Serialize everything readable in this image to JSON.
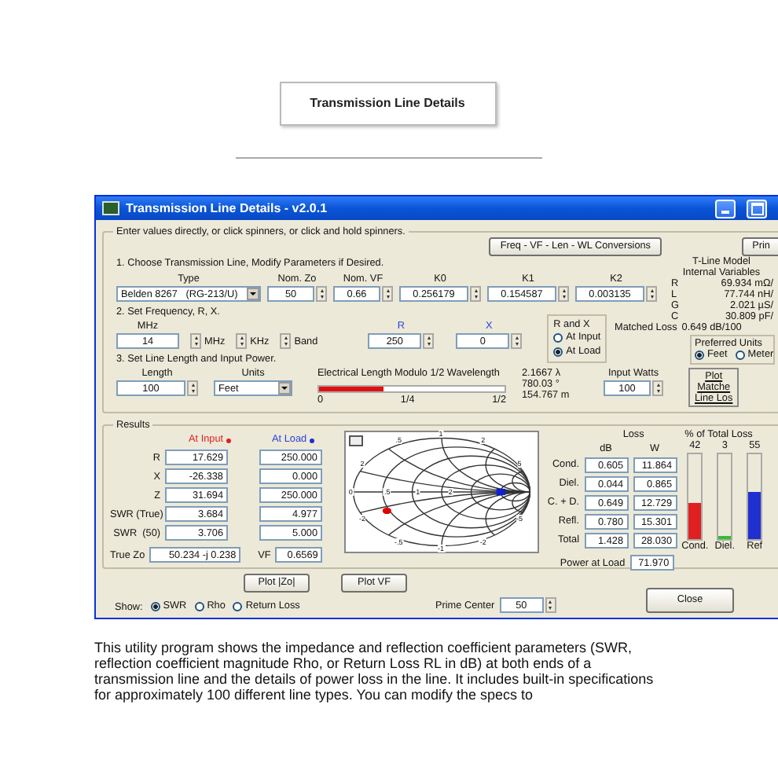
{
  "page": {
    "title": "Transmission Line Details",
    "description": "This utility program shows the impedance and reflection coefficient parameters (SWR, reflection coefficient magnitude Rho, or Return Loss RL in dB) at both ends of a transmission line and the details of power loss in the line. It includes built-in specifications for approximately 100 different line types. You can modify the specs to"
  },
  "window": {
    "title": "Transmission Line Details - v2.0.1"
  },
  "inputs": {
    "legend": "Enter values directly, or click spinners, or click and hold spinners.",
    "conversions_button": "Freq - VF - Len - WL Conversions",
    "print_button": "Prin",
    "step1": "1. Choose Transmission Line, Modify Parameters if Desired.",
    "line_params": [
      {
        "label": "Type",
        "value": "Belden 8267   (RG-213/U)",
        "kind": "dropdown"
      },
      {
        "label": "Nom. Zo",
        "value": "50",
        "kind": "spinner"
      },
      {
        "label": "Nom. VF",
        "value": "0.66",
        "kind": "spinner"
      },
      {
        "label": "K0",
        "value": "0.256179",
        "kind": "spinner"
      },
      {
        "label": "K1",
        "value": "0.154587",
        "kind": "spinner"
      },
      {
        "label": "K2",
        "value": "0.003135",
        "kind": "spinner"
      }
    ],
    "step2": "2. Set Frequency, R, X.",
    "frequency": {
      "label": "MHz",
      "value": "14",
      "steps": [
        "MHz",
        "KHz",
        "Band"
      ]
    },
    "impedance": [
      {
        "label": "R",
        "value": "250"
      },
      {
        "label": "X",
        "value": "0"
      }
    ],
    "r_and_x": {
      "title": "R and X",
      "options": [
        {
          "label": "At Input",
          "selected": false
        },
        {
          "label": "At Load",
          "selected": true
        }
      ]
    },
    "tline_model": {
      "title": "T-Line Model",
      "subtitle": "Internal Variables",
      "rows": [
        {
          "name": "R",
          "value": "69.934 mΩ/"
        },
        {
          "name": "L",
          "value": "77.744 nH/"
        },
        {
          "name": "G",
          "value": "2.021 µS/"
        },
        {
          "name": "C",
          "value": "30.809 pF/"
        }
      ],
      "matched_loss_label": "Matched Loss",
      "matched_loss_value": "0.649 dB/100"
    },
    "preferred_units": {
      "title": "Preferred Units",
      "options": [
        {
          "label": "Feet",
          "selected": true
        },
        {
          "label": "Meter",
          "selected": false
        }
      ]
    },
    "step3": "3. Set Line Length and Input Power.",
    "length": {
      "label": "Length",
      "value": "100"
    },
    "units": {
      "label": "Units",
      "value": "Feet"
    },
    "electrical_length": {
      "label": "Electrical Length Modulo 1/2 Wavelength",
      "level": 0.35,
      "ticks": [
        "0",
        "1/4",
        "1/2"
      ],
      "readings": [
        "2.1667 λ",
        "780.03 °",
        "154.767 m"
      ]
    },
    "input_watts": {
      "label": "Input Watts",
      "value": "100"
    },
    "plot_matched_button": [
      "Plot",
      "Matche",
      "Line Los"
    ]
  },
  "results": {
    "legend": "Results",
    "columns": [
      "At Input",
      "At Load"
    ],
    "rows": [
      {
        "label": "R",
        "input": "17.629",
        "load": "250.000"
      },
      {
        "label": "X",
        "input": "-26.338",
        "load": "0.000"
      },
      {
        "label": "Z",
        "input": "31.694",
        "load": "250.000"
      },
      {
        "label": "SWR (True)",
        "input": "3.684",
        "load": "4.977"
      },
      {
        "label": "SWR  (50)",
        "input": "3.706",
        "load": "5.000"
      }
    ],
    "true_zo_label": "True Zo",
    "true_zo": "50.234 -j 0.238",
    "vf_label": "VF",
    "vf": "0.6569",
    "smith_labels": [
      ".5",
      "1",
      "2",
      "2",
      "5",
      "0",
      ".5",
      "1",
      "2",
      "-2",
      "-5",
      "-.5",
      "-1",
      "-2"
    ],
    "loss": {
      "title": "Loss",
      "columns": [
        "dB",
        "W"
      ],
      "rows": [
        {
          "label": "Cond.",
          "db": "0.605",
          "w": "11.864"
        },
        {
          "label": "Diel.",
          "db": "0.044",
          "w": "0.865"
        },
        {
          "label": "C. + D.",
          "db": "0.649",
          "w": "12.729"
        },
        {
          "label": "Refl.",
          "db": "0.780",
          "w": "15.301"
        },
        {
          "label": "Total",
          "db": "1.428",
          "w": "28.030"
        }
      ],
      "power_at_load_label": "Power at Load",
      "power_at_load": "71.970"
    },
    "loss_share": {
      "title": "% of Total Loss",
      "bars": [
        {
          "label": "Cond.",
          "value": "42",
          "level": 0.42,
          "color": "#e02020"
        },
        {
          "label": "Diel.",
          "value": "3",
          "level": 0.03,
          "color": "#30c030"
        },
        {
          "label": "Ref",
          "value": "55",
          "level": 0.55,
          "color": "#2030d0"
        }
      ]
    }
  },
  "plot_buttons": [
    "Plot |Zo|",
    "Plot VF"
  ],
  "show": {
    "label": "Show:",
    "options": [
      {
        "label": "SWR",
        "selected": true
      },
      {
        "label": "Rho",
        "selected": false
      },
      {
        "label": "Return Loss",
        "selected": false
      }
    ]
  },
  "prime_center": {
    "label": "Prime Center",
    "value": "50"
  },
  "close_button": "Close"
}
